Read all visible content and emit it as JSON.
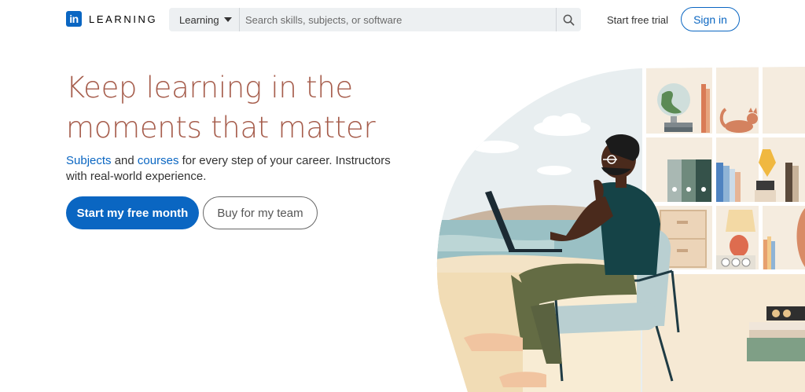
{
  "header": {
    "logo_badge": "in",
    "logo_word": "LEARNING",
    "search": {
      "scope": "Learning",
      "placeholder": "Search skills, subjects, or software"
    },
    "start_trial": "Start free trial",
    "sign_in": "Sign in"
  },
  "hero": {
    "title_line1": "Keep learning in the",
    "title_line2": "moments that matter",
    "sub_subjects": "Subjects",
    "sub_and": " and ",
    "sub_courses": "courses",
    "sub_rest": " for every step of your career. Instructors with real-world experience.",
    "primary_button": "Start my free month",
    "secondary_button": "Buy for my team"
  },
  "colors": {
    "brand": "#0a66c2",
    "title": "#a65d4c"
  },
  "icons": [
    "linkedin-logo-icon",
    "caret-down-icon",
    "search-icon"
  ]
}
